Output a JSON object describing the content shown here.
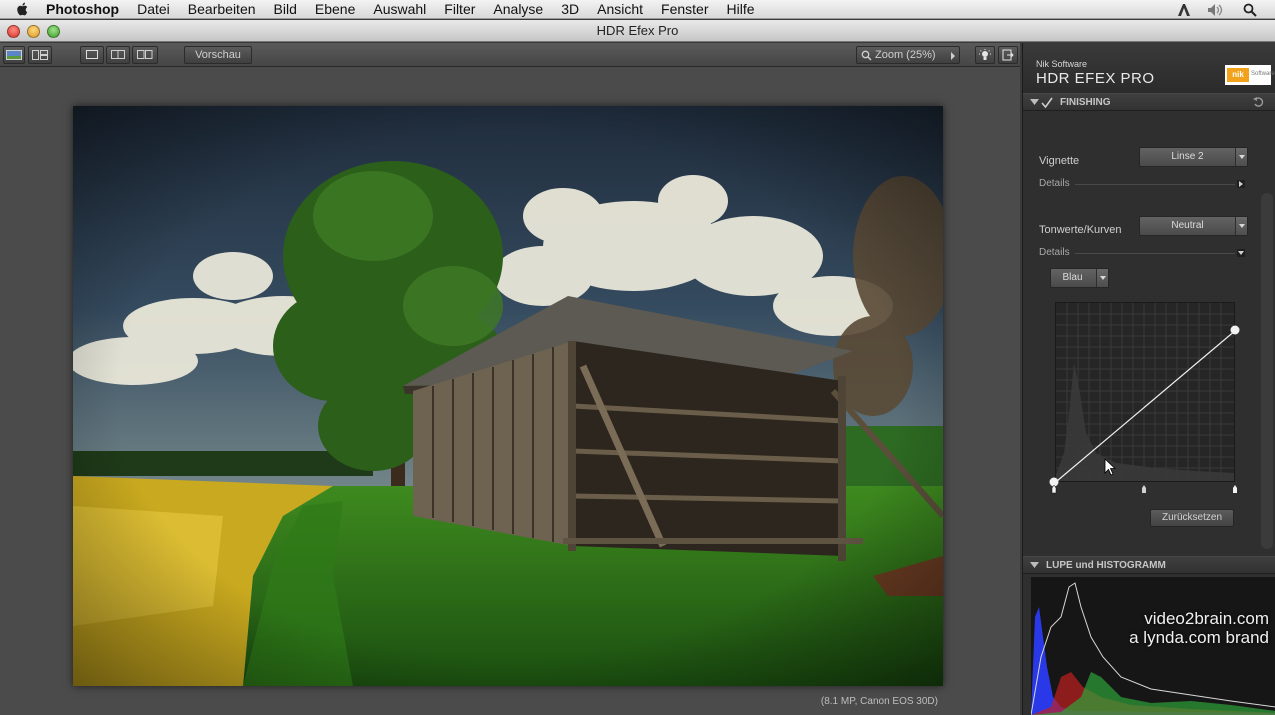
{
  "menubar": {
    "app_name": "Photoshop",
    "items": [
      "Datei",
      "Bearbeiten",
      "Bild",
      "Ebene",
      "Auswahl",
      "Filter",
      "Analyse",
      "3D",
      "Ansicht",
      "Fenster",
      "Hilfe"
    ]
  },
  "window": {
    "title": "HDR Efex Pro"
  },
  "toolbar": {
    "preview_label": "Vorschau",
    "zoom_label": "Zoom (25%)"
  },
  "canvas": {
    "meta_caption": "(8.1 MP, Canon EOS 30D)"
  },
  "panel": {
    "vendor": "Nik Software",
    "product": "HDR EFEX PRO",
    "logo_text": "nik",
    "logo_sub": "Software",
    "finishing": {
      "title": "FINISHING",
      "vignette_label": "Vignette",
      "vignette_value": "Linse 2",
      "details1_label": "Details",
      "tone_label": "Tonwerte/Kurven",
      "tone_value": "Neutral",
      "details2_label": "Details",
      "channel_value": "Blau",
      "reset_label": "Zurücksetzen"
    },
    "loupe": {
      "title": "LUPE und HISTOGRAMM"
    }
  },
  "watermark": {
    "line1": "video2brain.com",
    "line2": "a lynda.com brand"
  },
  "colors": {
    "panel_bg": "#2f2f2f",
    "brand_orange": "#f2a21b",
    "histo_blue": "#2b3dff",
    "histo_red": "#c11f1f",
    "histo_green": "#2fa23a"
  }
}
